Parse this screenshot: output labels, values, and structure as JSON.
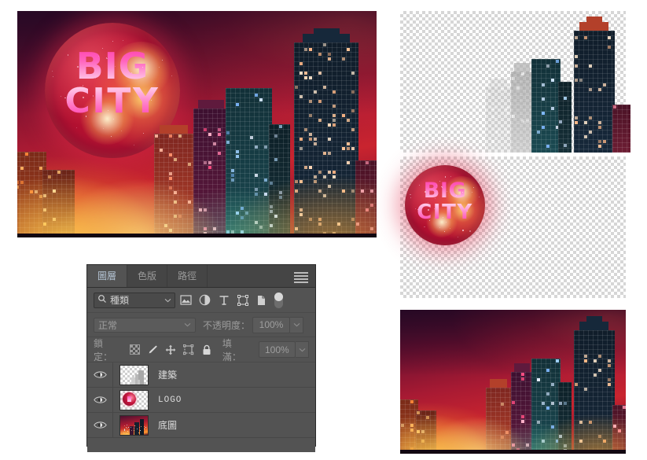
{
  "app": {
    "name": "Photoshop Layers Panel",
    "artwork_title": "BIG CITY"
  },
  "artwork": {
    "logo_line1": "BIG",
    "logo_line2": "CITY"
  },
  "panel": {
    "tabs": [
      {
        "label": "圖層",
        "active": true
      },
      {
        "label": "色版",
        "active": false
      },
      {
        "label": "路徑",
        "active": false
      }
    ],
    "menu_icon": "hamburger-menu-icon",
    "filter": {
      "search_icon": "search-icon",
      "kind_label": "種類",
      "chevron": "chevron-down-icon",
      "icons": [
        "image-filter-icon",
        "adjustment-filter-icon",
        "type-filter-icon",
        "shape-filter-icon",
        "smart-object-filter-icon"
      ],
      "toggle": "filter-enable-toggle"
    },
    "blend": {
      "mode": "正常",
      "mode_chevron": "chevron-down-icon",
      "opacity_label": "不透明度：",
      "opacity_value": "100%",
      "opacity_stepper": "chevron-down-icon"
    },
    "lock": {
      "label": "鎖定：",
      "icons": [
        "lock-transparent-pixels-icon",
        "lock-image-pixels-icon",
        "lock-position-icon",
        "lock-artboard-nesting-icon",
        "lock-all-icon"
      ],
      "fill_label": "填滿：",
      "fill_value": "100%",
      "fill_stepper": "chevron-down-icon"
    },
    "layers": [
      {
        "name": "建築",
        "visible": true,
        "thumb": "buildings-thumbnail",
        "mono": false
      },
      {
        "name": "LOGO",
        "visible": true,
        "thumb": "logo-thumbnail",
        "mono": true
      },
      {
        "name": "底圖",
        "visible": true,
        "thumb": "background-thumbnail",
        "mono": false
      }
    ]
  },
  "previews": [
    {
      "name": "建築 layer preview",
      "transparent": true
    },
    {
      "name": "LOGO layer preview",
      "transparent": true
    },
    {
      "name": "底圖 layer preview",
      "transparent": false
    }
  ],
  "colors": {
    "panel_bg": "#535353",
    "panel_tabbar": "#454545",
    "panel_border": "#2b2b2b",
    "text": "#dcdcdc",
    "muted_text": "#9c9c9c",
    "active_tab_text": "#b6c6d6",
    "logo_pink": "#ff45b0",
    "sky_red": "#c9242f",
    "glow_gold": "#ffcd50"
  }
}
